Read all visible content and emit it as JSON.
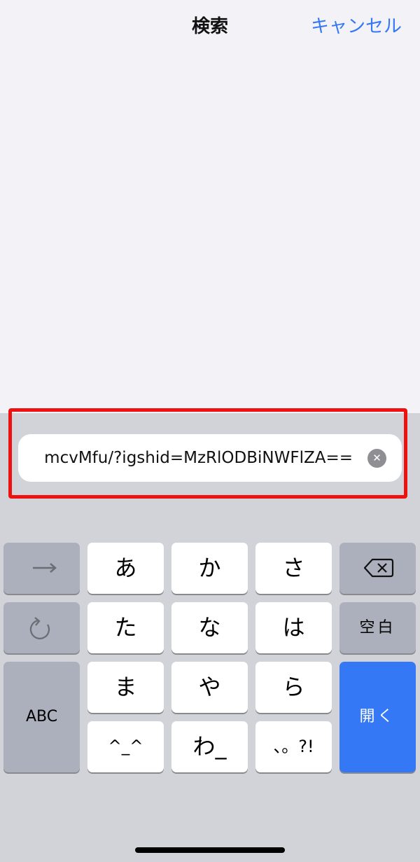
{
  "header": {
    "title": "検索",
    "cancel_label": "キャンセル"
  },
  "search": {
    "value": "mcvMfu/?igshid=MzRlODBiNWFlZA=="
  },
  "keyboard": {
    "row1": {
      "k1": "あ",
      "k2": "か",
      "k3": "さ"
    },
    "row2": {
      "k1": "た",
      "k2": "な",
      "k3": "は",
      "space": "空白"
    },
    "row3": {
      "k1": "ま",
      "k2": "や",
      "k3": "ら",
      "abc": "ABC",
      "open": "開く"
    },
    "row4": {
      "k1": "^_^",
      "k2": "わ_",
      "k3": "、。?!"
    }
  },
  "colors": {
    "accent": "#3478f6",
    "highlight": "#ee1111"
  }
}
